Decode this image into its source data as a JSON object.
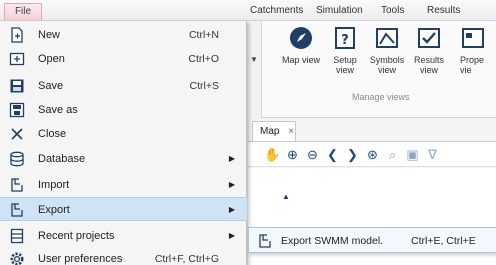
{
  "ribbon_tabs": {
    "file": "File",
    "catchments": "Catchments",
    "simulation": "Simulation",
    "tools": "Tools",
    "results": "Results"
  },
  "ribbon": {
    "buttons": {
      "map_view": "Map view",
      "setup_view": "Setup\nview",
      "symbols_view": "Symbols\nview",
      "results_view": "Results\nview",
      "properties_view": "Prope\nvie"
    },
    "group_label": "Manage views"
  },
  "map": {
    "tab_label": "Map",
    "tab_close": "×"
  },
  "file_menu": {
    "items": [
      {
        "label": "New",
        "shortcut": "Ctrl+N",
        "icon": "new-file-icon"
      },
      {
        "label": "Open",
        "shortcut": "Ctrl+O",
        "icon": "open-icon"
      },
      {
        "label": "Save",
        "shortcut": "Ctrl+S",
        "icon": "save-icon"
      },
      {
        "label": "Save as",
        "shortcut": "",
        "icon": "save-as-icon"
      },
      {
        "label": "Close",
        "shortcut": "",
        "icon": "close-icon"
      },
      {
        "label": "Database",
        "shortcut": "",
        "icon": "database-icon",
        "submenu": true
      },
      {
        "label": "Import",
        "shortcut": "",
        "icon": "import-icon",
        "submenu": true
      },
      {
        "label": "Export",
        "shortcut": "",
        "icon": "export-icon",
        "submenu": true,
        "highlighted": true
      },
      {
        "label": "Recent projects",
        "shortcut": "",
        "icon": "recent-projects-icon",
        "submenu": true
      },
      {
        "label": "User preferences",
        "shortcut": "Ctrl+F, Ctrl+G",
        "icon": "gear-icon"
      }
    ]
  },
  "export_submenu": {
    "label": "Export SWMM model.",
    "shortcut": "Ctrl+E, Ctrl+E"
  },
  "colors": {
    "menu_highlight": "#cfe3f6",
    "file_tab": "#f5cfd9",
    "icon_blue": "#1a4a7a"
  }
}
